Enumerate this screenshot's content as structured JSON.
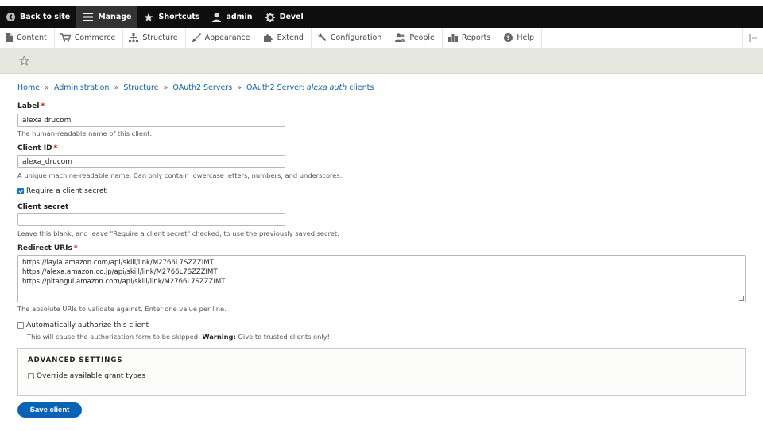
{
  "toolbar": {
    "back_to_site": "Back to site",
    "manage": "Manage",
    "shortcuts": "Shortcuts",
    "user": "admin",
    "devel": "Devel"
  },
  "menu": {
    "items": [
      {
        "label": "Content",
        "icon": "page-icon"
      },
      {
        "label": "Commerce",
        "icon": "cart-icon"
      },
      {
        "label": "Structure",
        "icon": "sitemap-icon"
      },
      {
        "label": "Appearance",
        "icon": "brush-icon"
      },
      {
        "label": "Extend",
        "icon": "puzzle-icon"
      },
      {
        "label": "Configuration",
        "icon": "wrench-icon"
      },
      {
        "label": "People",
        "icon": "people-icon"
      },
      {
        "label": "Reports",
        "icon": "bar-chart-icon"
      },
      {
        "label": "Help",
        "icon": "help-icon"
      }
    ]
  },
  "breadcrumb": {
    "home": "Home",
    "administration": "Administration",
    "structure": "Structure",
    "oauth2_servers": "OAuth2 Servers",
    "server_prefix": "OAuth2 Server:",
    "server_name": "alexa auth",
    "server_suffix": "clients",
    "separator": "»"
  },
  "form": {
    "label": {
      "title": "Label",
      "required": "*",
      "value": "alexa drucom",
      "description": "The human-readable name of this client."
    },
    "client_id": {
      "title": "Client ID",
      "required": "*",
      "value": "alexa_drucom",
      "description": "A unique machine-readable name. Can only contain lowercase letters, numbers, and underscores."
    },
    "require_secret": {
      "label": "Require a client secret",
      "checked": true
    },
    "client_secret": {
      "title": "Client secret",
      "value": "",
      "description": "Leave this blank, and leave \"Require a client secret\" checked, to use the previously saved secret."
    },
    "redirect_uris": {
      "title": "Redirect URIs",
      "required": "*",
      "lines": [
        "https://layla.amazon.com/api/skill/link/M2766L7SZZZIMT",
        "https://alexa.amazon.co.jp/api/skill/link/M2766L7SZZZIMT",
        "https://pitangui.amazon.com/api/skill/link/M2766L7SZZZIMT"
      ],
      "description": "The absolute URIs to validate against. Enter one value per line."
    },
    "auto_authorize": {
      "label": "Automatically authorize this client",
      "checked": false,
      "description_prefix": "This will cause the authorization form to be skipped.",
      "warning_label": "Warning:",
      "description_suffix": "Give to trusted clients only!"
    },
    "advanced": {
      "legend": "ADVANCED SETTINGS",
      "override_label": "Override available grant types",
      "override_checked": false
    },
    "save_label": "Save client"
  },
  "colors": {
    "toolbar_bg": "#0f0f0f",
    "link": "#0a62b5",
    "required": "#ee0000",
    "button": "#0a62b5"
  }
}
